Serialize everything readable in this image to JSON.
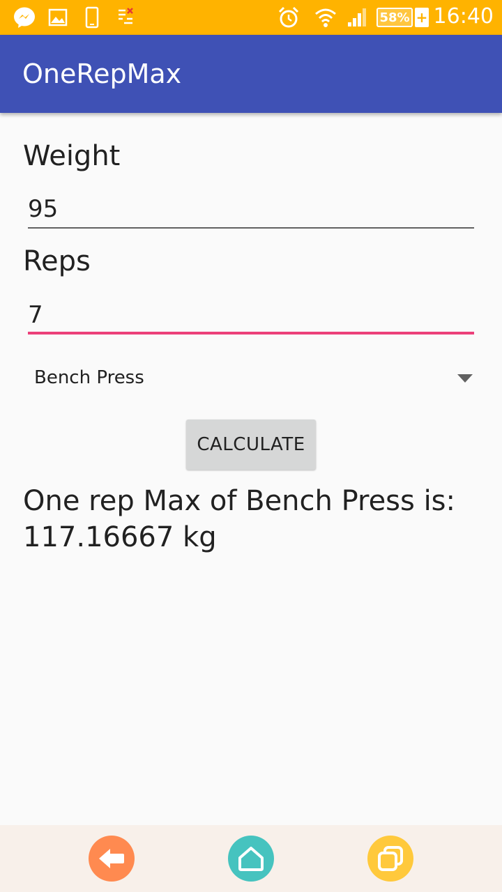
{
  "status_bar": {
    "time": "16:40",
    "battery_percent": "58%",
    "battery_plus": "+",
    "icons": [
      "messenger-icon",
      "gallery-icon",
      "phone-icon",
      "data-icon",
      "alarm-icon",
      "wifi-icon",
      "signal-icon",
      "battery-icon"
    ]
  },
  "app_bar": {
    "title": "OneRepMax"
  },
  "form": {
    "weight_label": "Weight",
    "weight_value": "95",
    "reps_label": "Reps",
    "reps_value": "7",
    "exercise_selected": "Bench Press",
    "calculate_label": "CALCULATE"
  },
  "result": {
    "line1": "One rep Max of Bench Press is:",
    "line2": "117.16667 kg"
  },
  "nav_bar": {
    "back_color": "#ff8a50",
    "home_color": "#46c3bf",
    "recents_color": "#ffc93c"
  },
  "colors": {
    "status_bar": "#ffb300",
    "app_bar": "#3f51b5",
    "accent": "#ec407a"
  }
}
